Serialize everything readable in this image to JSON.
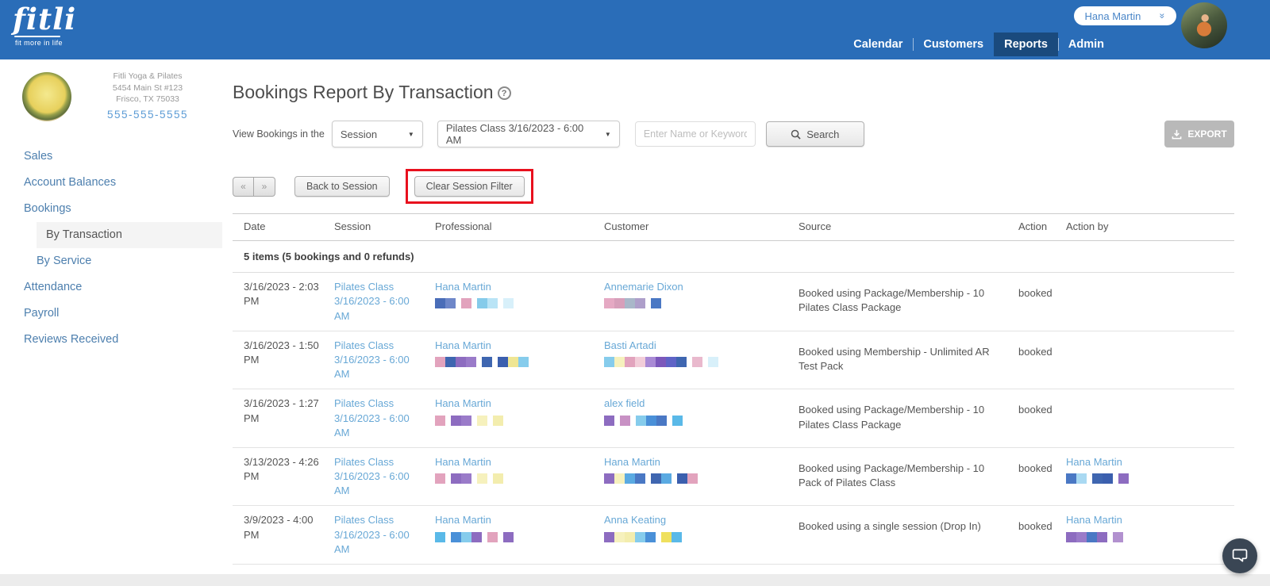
{
  "colors": {
    "brand_blue": "#2a6db8",
    "nav_active_blue": "#1a4a7d",
    "link_blue": "#68a8d6",
    "annotation_red": "#e8101e",
    "export_gray": "#b9b9b9",
    "chat_fab": "#3a4654"
  },
  "icons": {
    "select_caret": "▼",
    "user_chevron": "»",
    "help": "?",
    "search": "magnifier-icon",
    "export": "download-icon",
    "chat": "chat-bubble-icon"
  },
  "header": {
    "logo": {
      "brand": "fitli",
      "tagline": "fit more in life"
    },
    "user_menu": {
      "name": "Hana Martin"
    },
    "nav": [
      {
        "label": "Calendar",
        "active": false
      },
      {
        "label": "Customers",
        "active": false
      },
      {
        "label": "Reports",
        "active": true
      },
      {
        "label": "Admin",
        "active": false
      }
    ]
  },
  "sidebar": {
    "business": {
      "name": "Fitli Yoga & Pilates",
      "address_line1": "5454 Main St #123",
      "address_line2": "Frisco, TX 75033",
      "phone": "555-555-5555"
    },
    "items": [
      {
        "label": "Sales",
        "indent": false,
        "active": false
      },
      {
        "label": "Account Balances",
        "indent": false,
        "active": false
      },
      {
        "label": "Bookings",
        "indent": false,
        "active": false
      },
      {
        "label": "By Transaction",
        "indent": true,
        "active": true
      },
      {
        "label": "By Service",
        "indent": true,
        "active": false
      },
      {
        "label": "Attendance",
        "indent": false,
        "active": false
      },
      {
        "label": "Payroll",
        "indent": false,
        "active": false
      },
      {
        "label": "Reviews Received",
        "indent": false,
        "active": false
      }
    ]
  },
  "main": {
    "title": "Bookings Report By Transaction",
    "help_icon": "?",
    "filters": {
      "label": "View Bookings in the",
      "view_select_value": "Session",
      "session_select_value": "Pilates Class 3/16/2023 - 6:00 AM",
      "keyword_placeholder": "Enter Name or Keyword",
      "search_label": "Search",
      "export_label": "EXPORT"
    },
    "toolbar": {
      "prev": "«",
      "next": "»",
      "back_to_session": "Back to Session",
      "clear_session_filter": "Clear Session Filter"
    },
    "table": {
      "columns": [
        "Date",
        "Session",
        "Professional",
        "Customer",
        "Source",
        "Action",
        "Action by"
      ],
      "summary": "5 items (5 bookings and 0 refunds)",
      "rows": [
        {
          "date": "3/16/2023 - 2:03 PM",
          "session": "Pilates Class 3/16/2023 - 6:00 AM",
          "professional": {
            "name": "Hana Martin",
            "swatches": [
              [
                "#4a6db8",
                "#6e87c9"
              ],
              [
                "#e2a3bd"
              ],
              [
                "#85cbea",
                "#b9e4f6"
              ],
              [
                "#d8f0fa"
              ]
            ]
          },
          "customer": {
            "name": "Annemarie Dixon",
            "swatches": [
              [
                "#e5a9c3",
                "#d79fba",
                "#a9b7c9",
                "#ae9fca"
              ],
              [
                "#4a78c4"
              ]
            ]
          },
          "source": "Booked using Package/Membership - 10 Pilates Class Package",
          "action": "booked",
          "action_by": {
            "name": "",
            "swatches": []
          }
        },
        {
          "date": "3/16/2023 - 1:50 PM",
          "session": "Pilates Class 3/16/2023 - 6:00 AM",
          "professional": {
            "name": "Hana Martin",
            "swatches": [
              [
                "#e2a3bd",
                "#3f66b0",
                "#8d6cc0",
                "#9a7bc9"
              ],
              [
                "#3f66b0"
              ],
              [
                "#3b5fae",
                "#efe693",
                "#86ccec"
              ]
            ]
          },
          "customer": {
            "name": "Basti Artadi",
            "swatches": [
              [
                "#86ccec",
                "#f6f1bd",
                "#e2a3bd",
                "#f2cdd9",
                "#a98ad5",
                "#7c58bb",
                "#5f63c6",
                "#3f66b0"
              ],
              [
                "#e9b9cd"
              ],
              [
                "#d8f0fa"
              ]
            ]
          },
          "source": "Booked using Membership - Unlimited AR Test Pack",
          "action": "booked",
          "action_by": {
            "name": "",
            "swatches": []
          }
        },
        {
          "date": "3/16/2023 - 1:27 PM",
          "session": "Pilates Class 3/16/2023 - 6:00 AM",
          "professional": {
            "name": "Hana Martin",
            "swatches": [
              [
                "#e2a3bd"
              ],
              [
                "#8d6cc0",
                "#9a7bc9"
              ],
              [
                "#f6f1bd"
              ],
              [
                "#f3edae"
              ]
            ]
          },
          "customer": {
            "name": "alex field",
            "swatches": [
              [
                "#8d6cc0"
              ],
              [
                "#c891c4"
              ],
              [
                "#86ccec",
                "#4a90d8",
                "#4a78c4"
              ],
              [
                "#5ab9e8"
              ]
            ]
          },
          "source": "Booked using Package/Membership - 10 Pilates Class Package",
          "action": "booked",
          "action_by": {
            "name": "",
            "swatches": []
          }
        },
        {
          "date": "3/13/2023 - 4:26 PM",
          "session": "Pilates Class 3/16/2023 - 6:00 AM",
          "professional": {
            "name": "Hana Martin",
            "swatches": [
              [
                "#e2a3bd"
              ],
              [
                "#8d6cc0",
                "#9a7bc9"
              ],
              [
                "#f6f1bd"
              ],
              [
                "#f3edae"
              ]
            ]
          },
          "customer": {
            "name": "Hana Martin",
            "swatches": [
              [
                "#8d6cc0",
                "#f6f1bd",
                "#5aaae2",
                "#4a78c4"
              ],
              [
                "#3f66b0",
                "#5aaae2"
              ],
              [
                "#3b5fae",
                "#e2a3bd"
              ]
            ]
          },
          "source": "Booked using Package/Membership - 10 Pack of Pilates Class",
          "action": "booked",
          "action_by": {
            "name": "Hana Martin",
            "swatches": [
              [
                "#4a78c4",
                "#a9d9f2"
              ],
              [
                "#3f66b0",
                "#3b5fae"
              ],
              [
                "#8d6cc0"
              ]
            ]
          }
        },
        {
          "date": "3/9/2023 - 4:00 PM",
          "session": "Pilates Class 3/16/2023 - 6:00 AM",
          "professional": {
            "name": "Hana Martin",
            "swatches": [
              [
                "#5ab9e8"
              ],
              [
                "#4a90d8",
                "#86ccec",
                "#8d6cc0"
              ],
              [
                "#e2a3bd"
              ],
              [
                "#8d6cc0"
              ]
            ]
          },
          "customer": {
            "name": "Anna Keating",
            "swatches": [
              [
                "#8d6cc0",
                "#f6f1bd",
                "#f3edae",
                "#86ccec",
                "#4a90d8"
              ],
              [
                "#efe05e",
                "#5ab9e8"
              ]
            ]
          },
          "source": "Booked using a single session (Drop In)",
          "action": "booked",
          "action_by": {
            "name": "Hana Martin",
            "swatches": [
              [
                "#8d6cc0",
                "#9a7bc9",
                "#4a78c4",
                "#8d6cc0"
              ],
              [
                "#b291cf"
              ]
            ]
          }
        }
      ]
    }
  }
}
